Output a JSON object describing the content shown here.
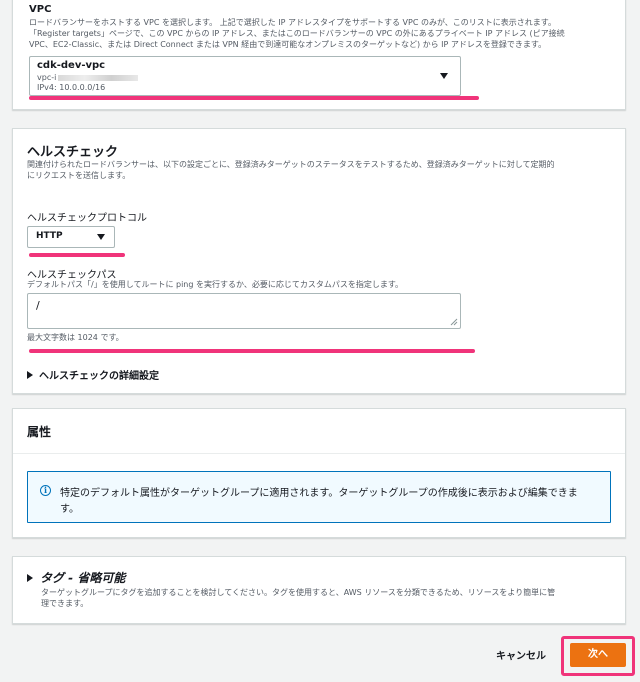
{
  "vpc": {
    "label": "VPC",
    "desc1": "ロードバランサーをホストする VPC を選択します。 上記で選択した IP アドレスタイプをサポートする VPC のみが、このリストに表示されます。",
    "desc2": "「Register targets」ページで、この VPC からの IP アドレス、またはこのロードバランサーの VPC の外にあるプライベート IP アドレス (ピア接続",
    "desc3": "VPC、EC2-Classic、または Direct Connect または VPN 経由で到達可能なオンプレミスのターゲットなど) から IP アドレスを登録できます。",
    "selected_name": "cdk-dev-vpc",
    "selected_id": "vpc-i",
    "selected_cidr": "IPv4: 10.0.0.0/16"
  },
  "health": {
    "title": "ヘルスチェック",
    "desc1": "関連付けられたロードバランサーは、以下の設定ごとに、登録済みターゲットのステータスをテストするため、登録済みターゲットに対して定期的",
    "desc2": "にリクエストを送信します。",
    "protocol_label": "ヘルスチェックプロトコル",
    "protocol_value": "HTTP",
    "path_label": "ヘルスチェックパス",
    "path_desc": "デフォルトパス「/」を使用してルートに ping を実行するか、必要に応じてカスタムパスを指定します。",
    "path_value": "/",
    "path_hint": "最大文字数は 1024 です。",
    "advanced": "ヘルスチェックの詳細設定"
  },
  "attributes": {
    "title": "属性",
    "info1": "特定のデフォルト属性がターゲットグループに適用されます。ターゲットグループの作成後に表示および編集できま",
    "info2": "す。"
  },
  "tags": {
    "title": "タグ - 省略可能",
    "desc1": "ターゲットグループにタグを追加することを検討してください。タグを使用すると、AWS リソースを分類できるため、リソースをより簡単に管",
    "desc2": "理できます。"
  },
  "footer": {
    "cancel": "キャンセル",
    "next": "次へ"
  },
  "colors": {
    "accent": "#ec7211",
    "highlight": "#f0347a",
    "info": "#0073bb"
  }
}
